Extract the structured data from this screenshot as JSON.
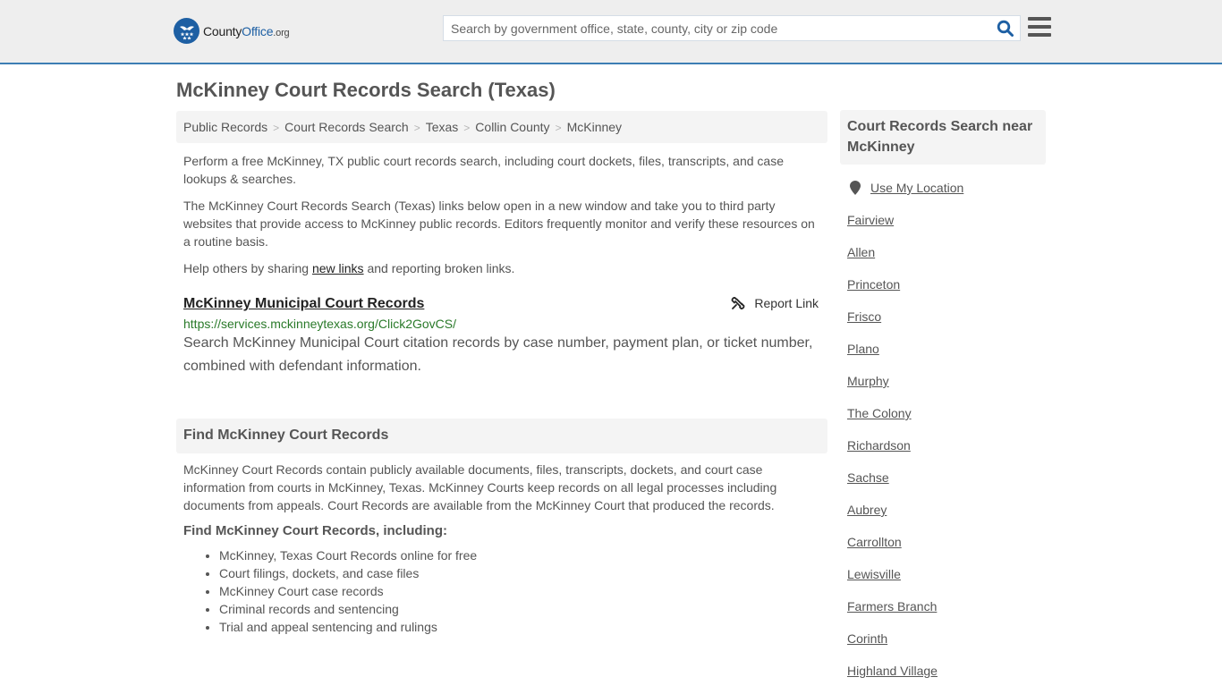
{
  "header": {
    "logo": {
      "county": "County",
      "office": "Office",
      "org": ".org"
    },
    "search_placeholder": "Search by government office, state, county, city or zip code",
    "search_value": "",
    "icons": {
      "search": "search-icon",
      "menu": "hamburger-menu-icon",
      "logo": "eagle-stars-icon"
    },
    "colors": {
      "brand_blue": "#1d5fa3",
      "accent_border": "#3d7eb4"
    }
  },
  "page": {
    "title": "McKinney Court Records Search (Texas)"
  },
  "breadcrumb": [
    {
      "label": "Public Records"
    },
    {
      "label": "Court Records Search"
    },
    {
      "label": "Texas"
    },
    {
      "label": "Collin County"
    },
    {
      "label": "McKinney"
    }
  ],
  "intro": {
    "p1": "Perform a free McKinney, TX public court records search, including court dockets, files, transcripts, and case lookups & searches.",
    "p2": "The McKinney Court Records Search (Texas) links below open in a new window and take you to third party websites that provide access to McKinney public records. Editors frequently monitor and verify these resources on a routine basis.",
    "p3_before": "Help others by sharing ",
    "p3_link": "new links",
    "p3_after": " and reporting broken links."
  },
  "results": [
    {
      "title": "McKinney Municipal Court Records",
      "url": "https://services.mckinneytexas.org/Click2GovCS/",
      "description": "Search McKinney Municipal Court citation records by case number, payment plan, or ticket number, combined with defendant information.",
      "report_label": "Report Link",
      "report_icon": "broken-link-icon"
    }
  ],
  "find_section": {
    "heading": "Find McKinney Court Records",
    "body": "McKinney Court Records contain publicly available documents, files, transcripts, dockets, and court case information from courts in McKinney, Texas. McKinney Courts keep records on all legal processes including documents from appeals. Court Records are available from the McKinney Court that produced the records.",
    "subheading": "Find McKinney Court Records, including:",
    "bullets": [
      "McKinney, Texas Court Records online for free",
      "Court filings, dockets, and case files",
      "McKinney Court case records",
      "Criminal records and sentencing",
      "Trial and appeal sentencing and rulings"
    ]
  },
  "sidebar": {
    "heading": "Court Records Search near McKinney",
    "use_location": "Use My Location",
    "location_icon": "map-pin-icon",
    "cities": [
      "Fairview",
      "Allen",
      "Princeton",
      "Frisco",
      "Plano",
      "Murphy",
      "The Colony",
      "Richardson",
      "Sachse",
      "Aubrey",
      "Carrollton",
      "Lewisville",
      "Farmers Branch",
      "Corinth",
      "Highland Village"
    ]
  }
}
